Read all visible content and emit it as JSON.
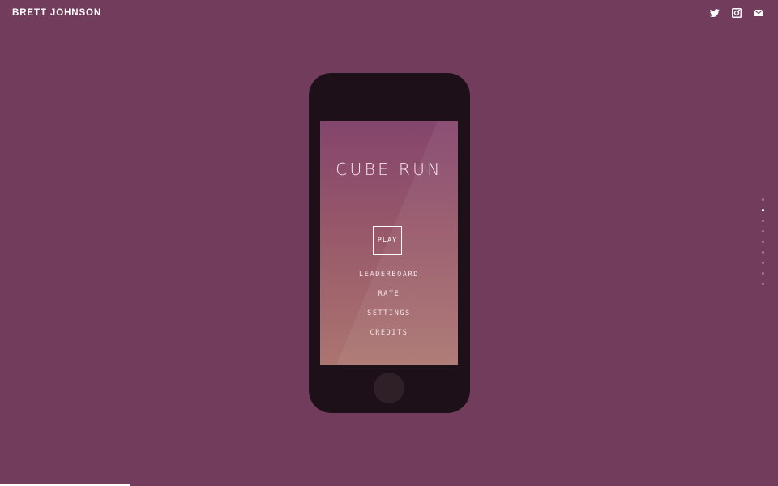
{
  "header": {
    "brand": "BRETT JOHNSON",
    "social": [
      {
        "icon": "twitter-icon"
      },
      {
        "icon": "instagram-icon"
      },
      {
        "icon": "mail-icon"
      }
    ]
  },
  "phone": {
    "title": "CUBE RUN",
    "play_label": "PLAY",
    "menu": [
      "LEADERBOARD",
      "RATE",
      "SETTINGS",
      "CREDITS"
    ]
  },
  "pagination": {
    "count": 9,
    "active_index": 1
  },
  "progress": {
    "fraction": 0.1667
  },
  "colors": {
    "background": "#723c5c",
    "phone_body": "#1e1018",
    "screen_top": "#84456d",
    "screen_bottom": "#ab7570",
    "accent": "#ffffff"
  }
}
